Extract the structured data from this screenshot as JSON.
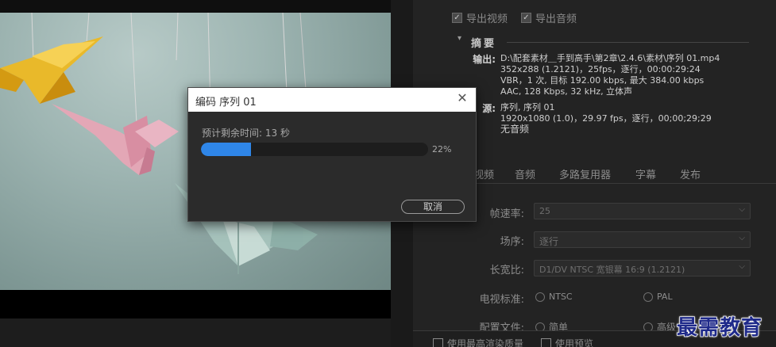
{
  "export": {
    "export_video_label": "导出视频",
    "export_audio_label": "导出音频",
    "export_video_checked": true,
    "export_audio_checked": true
  },
  "summary": {
    "title": "摘要",
    "output_label": "输出:",
    "output_path": "D:\\配套素材＿手到高手\\第2章\\2.4.6\\素材\\序列 01.mp4",
    "output_video": "352x288 (1.2121)，25fps，逐行，00:00:29:24",
    "output_bitrate": "VBR，1 次, 目标 192.00 kbps, 最大 384.00 kbps",
    "output_audio": "AAC, 128 Kbps, 32  kHz, 立体声",
    "source_label": "源:",
    "source_name": "序列, 序列 01",
    "source_video": "1920x1080 (1.0)，29.97 fps，逐行，00;00;29;29",
    "source_audio": "无音频"
  },
  "tabs": [
    "视频",
    "音频",
    "多路复用器",
    "字幕",
    "发布"
  ],
  "fields": {
    "frame_rate_label": "帧速率:",
    "frame_rate_value": "25",
    "field_order_label": "场序:",
    "field_order_value": "逐行",
    "aspect_label": "长宽比:",
    "aspect_value": "D1/DV NTSC 宽银幕 16:9 (1.2121)",
    "tv_standard_label": "电视标准:",
    "tv_ntsc": "NTSC",
    "tv_pal": "PAL",
    "profile_label": "配置文件:",
    "profile_simple": "简单",
    "profile_advanced": "高级"
  },
  "bottom": {
    "max_render_quality": "使用最高渲染质量",
    "use_previews": "使用预览"
  },
  "dialog": {
    "title": "编码 序列 01",
    "close_glyph": "✕",
    "remaining_time": "预计剩余时间: 13 秒",
    "progress": 0.22,
    "progress_text": "22%",
    "cancel_label": "取消"
  },
  "watermark": "最需教育",
  "colors": {
    "progress_fill": "#2f86e8",
    "dialog_bg": "#2b2b2b",
    "panel_bg": "#232323",
    "watermark": "#1f2a8a"
  }
}
